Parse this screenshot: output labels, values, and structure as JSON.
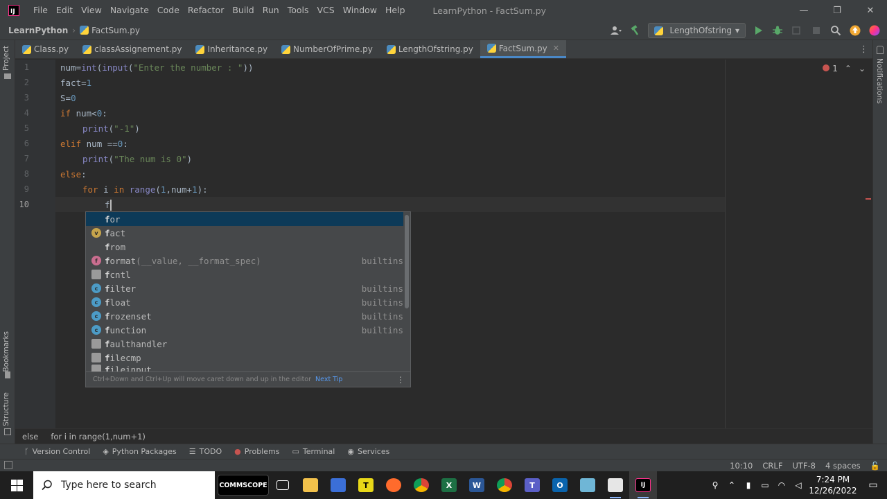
{
  "titlebar": {
    "logo_text": "IJ",
    "menu": [
      "File",
      "Edit",
      "View",
      "Navigate",
      "Code",
      "Refactor",
      "Build",
      "Run",
      "Tools",
      "VCS",
      "Window",
      "Help"
    ],
    "window_title": "LearnPython - FactSum.py",
    "minimize": "—",
    "restore": "❐",
    "close": "✕"
  },
  "navbar": {
    "project": "LearnPython",
    "file": "FactSum.py",
    "run_config": "LengthOfstring"
  },
  "tool_strips": {
    "project": "Project",
    "bookmarks": "Bookmarks",
    "structure": "Structure",
    "notifications": "Notifications"
  },
  "tabs": [
    {
      "label": "Class.py"
    },
    {
      "label": "classAssignement.py"
    },
    {
      "label": "Inheritance.py"
    },
    {
      "label": "NumberOfPrime.py"
    },
    {
      "label": "LengthOfstring.py"
    },
    {
      "label": "FactSum.py",
      "close": "✕"
    }
  ],
  "editor": {
    "line_numbers": [
      "1",
      "2",
      "3",
      "4",
      "5",
      "6",
      "7",
      "8",
      "9",
      "10"
    ],
    "error_count": "1",
    "code": {
      "l1_a": "num=",
      "l1_b": "int",
      "l1_c": "(",
      "l1_d": "input",
      "l1_e": "(",
      "l1_f": "\"Enter the number : \"",
      "l1_g": "))",
      "l2_a": "fact=",
      "l2_b": "1",
      "l3_a": "S=",
      "l3_b": "0",
      "l4_a": "if ",
      "l4_b": "num<",
      "l4_c": "0",
      "l4_d": ":",
      "l5_a": "print",
      "l5_b": "(",
      "l5_c": "\"-1\"",
      "l5_d": ")",
      "l6_a": "elif ",
      "l6_b": "num ==",
      "l6_c": "0",
      "l6_d": ":",
      "l7_a": "print",
      "l7_b": "(",
      "l7_c": "\"The num is 0\"",
      "l7_d": ")",
      "l8_a": "else",
      "l8_b": ":",
      "l9_a": "for ",
      "l9_b": "i ",
      "l9_c": "in ",
      "l9_d": "range",
      "l9_e": "(",
      "l9_f": "1",
      "l9_g": ",num+",
      "l9_h": "1",
      "l9_i": "):",
      "l10_a": "f"
    }
  },
  "completion": {
    "items": [
      {
        "icon": "",
        "head": "f",
        "rest": "or",
        "sig": "",
        "src": ""
      },
      {
        "icon": "v",
        "head": "f",
        "rest": "act",
        "sig": "",
        "src": ""
      },
      {
        "icon": "",
        "head": "f",
        "rest": "rom",
        "sig": "",
        "src": ""
      },
      {
        "icon": "f",
        "head": "f",
        "rest": "ormat",
        "sig": "(__value, __format_spec)",
        "src": "builtins"
      },
      {
        "icon": "mod",
        "head": "f",
        "rest": "cntl",
        "sig": "",
        "src": ""
      },
      {
        "icon": "c",
        "head": "f",
        "rest": "ilter",
        "sig": "",
        "src": "builtins"
      },
      {
        "icon": "c",
        "head": "f",
        "rest": "loat",
        "sig": "",
        "src": "builtins"
      },
      {
        "icon": "c",
        "head": "f",
        "rest": "rozenset",
        "sig": "",
        "src": "builtins"
      },
      {
        "icon": "c",
        "head": "f",
        "rest": "unction",
        "sig": "",
        "src": "builtins"
      },
      {
        "icon": "mod",
        "head": "f",
        "rest": "aulthandler",
        "sig": "",
        "src": ""
      },
      {
        "icon": "mod",
        "head": "f",
        "rest": "ilecmp",
        "sig": "",
        "src": ""
      },
      {
        "icon": "mod",
        "head": "f",
        "rest": "ileinput",
        "sig": "",
        "src": ""
      }
    ],
    "footer_hint": "Ctrl+Down and Ctrl+Up will move caret down and up in the editor",
    "footer_link": "Next Tip",
    "more": "⋮"
  },
  "code_crumbs": [
    "else",
    "for i in range(1,num+1)"
  ],
  "tool_windows": [
    {
      "icon": "ᚴ",
      "label": "Version Control"
    },
    {
      "icon": "◈",
      "label": "Python Packages"
    },
    {
      "icon": "☰",
      "label": "TODO"
    },
    {
      "icon": "●",
      "label": "Problems"
    },
    {
      "icon": "▭",
      "label": "Terminal"
    },
    {
      "icon": "◉",
      "label": "Services"
    }
  ],
  "status": {
    "position": "10:10",
    "line_sep": "CRLF",
    "encoding": "UTF-8",
    "indent": "4 spaces",
    "lock": "🔓"
  },
  "taskbar": {
    "search_placeholder": "Type here to search",
    "commscope": "COMMSCOPE",
    "time": "7:24 PM",
    "date": "12/26/2022"
  },
  "colors": {
    "accent": "#4a88c7",
    "keyword": "#cc7832",
    "string": "#6a8759",
    "number": "#6897bb",
    "builtin": "#8888c6",
    "error": "#c75450"
  }
}
